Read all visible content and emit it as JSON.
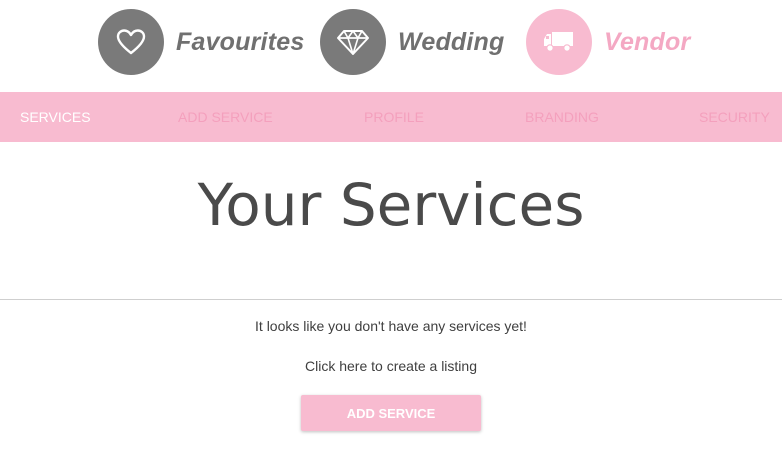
{
  "colors": {
    "pink": "#f8bbd0",
    "pink_text": "#f4a8c3",
    "grey_circle": "#7a7a7a",
    "grey_text": "#707070",
    "white": "#ffffff"
  },
  "roles": [
    {
      "label": "Favourites",
      "icon": "heart-icon",
      "active": false
    },
    {
      "label": "Wedding",
      "icon": "diamond-icon",
      "active": false
    },
    {
      "label": "Vendor",
      "icon": "truck-icon",
      "active": true
    }
  ],
  "nav": {
    "items": [
      {
        "label": "SERVICES",
        "active": true
      },
      {
        "label": "ADD SERVICE",
        "active": false
      },
      {
        "label": "PROFILE",
        "active": false
      },
      {
        "label": "BRANDING",
        "active": false
      },
      {
        "label": "SECURITY",
        "active": false
      }
    ]
  },
  "main": {
    "title": "Your Services",
    "empty_message": "It looks like you don't have any services yet!",
    "cta_message": "Click here to create a listing",
    "add_button_label": "ADD SERVICE"
  }
}
